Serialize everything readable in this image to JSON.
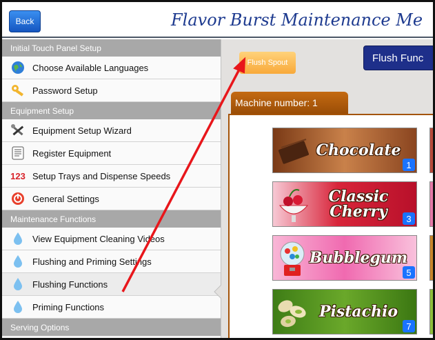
{
  "header": {
    "back_label": "Back",
    "title": "Flavor Burst Maintenance Me"
  },
  "sidebar": {
    "sections": [
      {
        "label": "Initial Touch Panel Setup",
        "items": [
          {
            "label": "Choose Available Languages",
            "icon": "globe-icon"
          },
          {
            "label": "Password Setup",
            "icon": "key-icon"
          }
        ]
      },
      {
        "label": "Equipment Setup",
        "items": [
          {
            "label": "Equipment Setup Wizard",
            "icon": "tools-icon"
          },
          {
            "label": "Register Equipment",
            "icon": "document-icon"
          },
          {
            "label": "Setup Trays and Dispense Speeds",
            "icon": "numbers-icon",
            "icon_text": "123"
          },
          {
            "label": "General Settings",
            "icon": "power-icon"
          }
        ]
      },
      {
        "label": "Maintenance Functions",
        "items": [
          {
            "label": "View Equipment Cleaning Videos",
            "icon": "droplet-icon"
          },
          {
            "label": "Flushing and Priming Settings",
            "icon": "droplet-icon"
          },
          {
            "label": "Flushing Functions",
            "icon": "droplet-icon",
            "selected": true
          },
          {
            "label": "Priming Functions",
            "icon": "droplet-icon"
          }
        ]
      },
      {
        "label": "Serving Options",
        "items": []
      }
    ]
  },
  "main": {
    "flush_spout_label": "Flush Spout",
    "flush_functions_label": "Flush Func",
    "machine_tab_label": "Machine number: 1",
    "flavors": [
      {
        "name": "Chocolate",
        "number": "1",
        "color": "#a85a2a"
      },
      {
        "name": "Classic Cherry",
        "number": "3",
        "color": "#d8253a"
      },
      {
        "name": "Bubblegum",
        "number": "5",
        "color": "#f06ab0"
      },
      {
        "name": "Pistachio",
        "number": "7",
        "color": "#4d8f1e"
      }
    ]
  },
  "colors": {
    "accent_blue": "#1e2f8a",
    "back_blue": "#1a6ee0",
    "machine_tab": "#b85f0c",
    "arrow_red": "#e8161b"
  }
}
